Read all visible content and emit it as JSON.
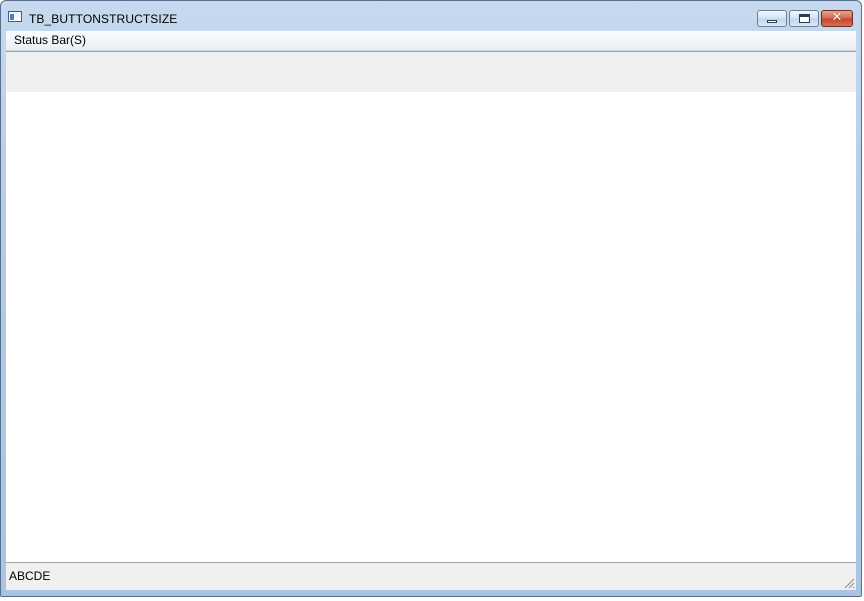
{
  "window": {
    "title": "TB_BUTTONSTRUCTSIZE",
    "app_icon": "window-icon",
    "caption_buttons": {
      "minimize_icon": "minimize-icon",
      "maximize_icon": "maximize-icon",
      "close_icon": "close-icon",
      "close_glyph": "✕"
    }
  },
  "menubar": {
    "items": [
      {
        "label": "Status Bar(S)"
      }
    ]
  },
  "statusbar": {
    "text": "ABCDE",
    "grip_icon": "resize-grip-icon"
  },
  "colors": {
    "titlebar": "#b3cbe6",
    "close_button": "#c3432a",
    "toolbar_bg": "#f0f0f0",
    "statusbar_bg": "#f0f0f0"
  }
}
